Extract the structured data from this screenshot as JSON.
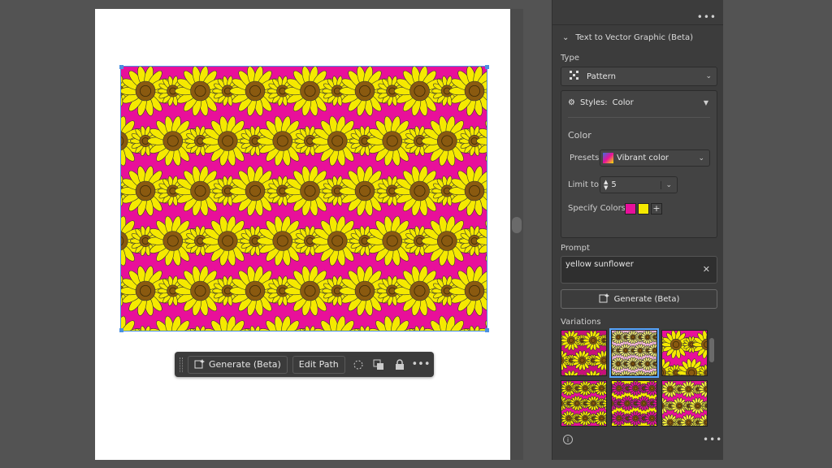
{
  "taskbar": {
    "generate_label": "Generate (Beta)",
    "edit_path_label": "Edit Path"
  },
  "panel": {
    "section_title": "Text to Vector Graphic (Beta)",
    "type_label": "Type",
    "type_value": "Pattern",
    "styles_label": "Styles:",
    "styles_value": "Color",
    "color_heading": "Color",
    "presets_label": "Presets:",
    "presets_value": "Vibrant color",
    "limit_label": "Limit to:",
    "limit_value": "5",
    "specify_colors_label": "Specify Colors:",
    "specify_colors": [
      "#e8109a",
      "#f5e900"
    ],
    "prompt_label": "Prompt",
    "prompt_value": "yellow sunflower",
    "generate_label": "Generate (Beta)",
    "variations_label": "Variations"
  },
  "colors": {
    "pattern_background": "#e8109a",
    "petal_yellow": "#f5e900",
    "flower_center": "#8a5a10",
    "selection_blue": "#4a90e2",
    "variation_selected": "#59a7ff"
  },
  "icons": {
    "taskbar": [
      "grip-icon",
      "generate-icon",
      "recolor-icon",
      "duplicate-icon",
      "lock-icon",
      "more-icon"
    ],
    "panel": [
      "chevron-down-icon",
      "pattern-icon",
      "gear-icon",
      "stepper-icon",
      "plus-icon",
      "close-icon",
      "info-icon",
      "more-icon"
    ]
  }
}
